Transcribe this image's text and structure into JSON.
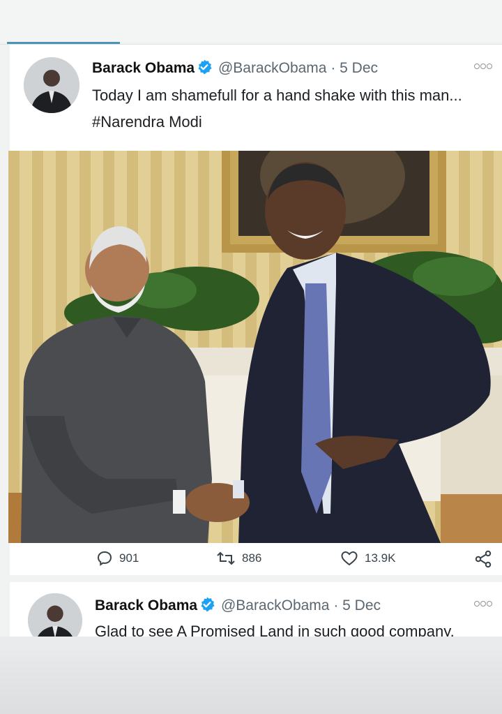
{
  "colors": {
    "verified_blue": "#1da1f2",
    "tab_accent": "#4a94b8",
    "secondary_text": "#5b6770"
  },
  "tweet1": {
    "author_name": "Barack Obama",
    "handle": "@BarackObama",
    "separator": "·",
    "date": "5 Dec",
    "text": "Today I am shamefull for a hand shake with this man... #Narendra Modi",
    "icons": [
      "verified-icon",
      "more-options-icon",
      "avatar"
    ]
  },
  "photo": {
    "content": "Two men shaking hands in front of a framed painting and plants",
    "icon": "photo"
  },
  "actions": {
    "replies": "901",
    "retweets": "886",
    "likes": "13.9K",
    "icons": [
      "reply-icon",
      "retweet-icon",
      "like-icon",
      "share-icon"
    ]
  },
  "tweet2": {
    "author_name": "Barack Obama",
    "handle": "@BarackObama",
    "separator": "·",
    "date": "5 Dec",
    "text": "Glad to see A Promised Land in such good company."
  }
}
